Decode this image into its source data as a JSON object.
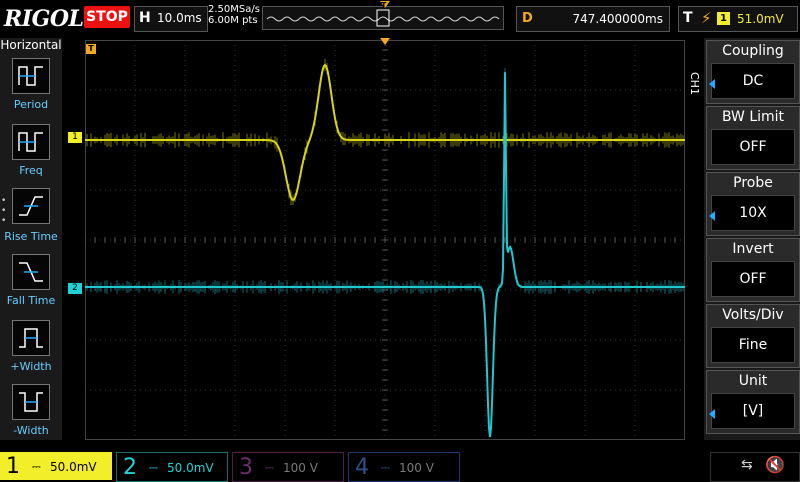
{
  "top": {
    "logo": "RIGOL",
    "run_state": "STOP",
    "horizontal_label": "H",
    "timebase": "10.0ms",
    "sample_rate": "2.50MSa/s",
    "memory_depth": "6.00M pts",
    "delay_label": "D",
    "delay": "747.400000ms",
    "trigger_label": "T",
    "trigger_channel": "1",
    "trigger_level": "51.0mV"
  },
  "left_menu": {
    "title": "Horizontal",
    "items": [
      {
        "label": "Period"
      },
      {
        "label": "Freq"
      },
      {
        "label": "Rise Time"
      },
      {
        "label": "Fall Time"
      },
      {
        "label": "+Width"
      },
      {
        "label": "-Width"
      }
    ]
  },
  "right_menu": {
    "channel_tag": "CH1",
    "items": [
      {
        "title": "Coupling",
        "value": "DC"
      },
      {
        "title": "BW Limit",
        "value": "OFF"
      },
      {
        "title": "Probe",
        "value": "10X"
      },
      {
        "title": "Invert",
        "value": "OFF"
      },
      {
        "title": "Volts/Div",
        "value": "Fine"
      },
      {
        "title": "Unit",
        "value": "[V]"
      }
    ]
  },
  "channels": [
    {
      "num": "1",
      "scale": "50.0mV",
      "color": "#f2ef2a",
      "active": true
    },
    {
      "num": "2",
      "scale": "50.0mV",
      "color": "#22d3d6",
      "active": true
    },
    {
      "num": "3",
      "scale": "100 V",
      "color": "#d62ad6",
      "active": false
    },
    {
      "num": "4",
      "scale": "100 V",
      "color": "#2a6cf2",
      "active": false
    }
  ],
  "markers": {
    "ch1_label": "1",
    "ch2_label": "2",
    "trigger_marker_label": "T"
  },
  "colors": {
    "ch1": "#d8d419",
    "ch2": "#1fc7cf",
    "accent": "#f5a623",
    "stop": "#e11"
  }
}
